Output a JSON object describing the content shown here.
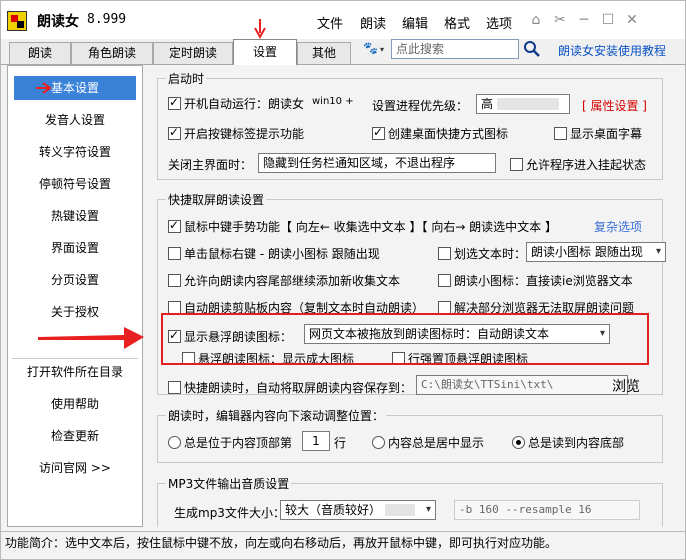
{
  "app": {
    "title": "朗读女",
    "version": "8.999"
  },
  "menu": [
    "文件",
    "朗读",
    "编辑",
    "格式",
    "选项"
  ],
  "tabs": [
    "朗读",
    "角色朗读",
    "定时朗读",
    "设置",
    "其他"
  ],
  "search": {
    "placeholder": "点此搜索"
  },
  "help_link": "朗读女安装使用教程",
  "sidebar": {
    "top": [
      "基本设置",
      "发音人设置",
      "转义字符设置",
      "停顿符号设置",
      "热键设置",
      "界面设置",
      "分页设置",
      "关于授权"
    ],
    "bottom": [
      "打开软件所在目录",
      "使用帮助",
      "检查更新",
      "访问官网 >>"
    ]
  },
  "startup": {
    "title": "启动时",
    "autorun": "开机自动运行：朗读女",
    "os": "win10 +",
    "priority_label": "设置进程优先级：",
    "priority_value": "高",
    "attr_link": "[ 属性设置 ]",
    "shortcut_gesture": "开启按键标签提示功能",
    "desktop_icon": "创建桌面快捷方式图标",
    "desktop_subtitle": "显示桌面字幕",
    "close_label": "关闭主界面时：",
    "close_value": "隐藏到任务栏通知区域，不退出程序",
    "allow_suspend": "允许程序进入挂起状态"
  },
  "capture": {
    "title": "快捷取屏朗读设置",
    "middle_gesture": "鼠标中键手势功能【 向左← 收集选中文本 】【 向右→ 朗读选中文本 】",
    "restore": "复杂选项",
    "right_click": "单击鼠标右键 - 朗读小图标 跟随出现",
    "select_text_label": "划选文本时：",
    "select_text_value": "朗读小图标 跟随出现",
    "allow_append": "允许向朗读内容尾部继续添加新收集文本",
    "mini_icon": "朗读小图标：直接读ie浏览器文本",
    "auto_clip": "自动朗读剪贴板内容（复制文本时自动朗读）",
    "solve_browser": "解决部分浏览器无法取屏朗读问题",
    "float_icon": "显示悬浮朗读图标：",
    "float_value": "网页文本被拖放到朗读图标时：自动朗读文本",
    "float_big": "悬浮朗读图标：显示成大图标",
    "float_top": "行强置顶悬浮朗读图标",
    "save_label": "快捷朗读时，自动将取屏朗读内容保存到：",
    "save_path": "C:\\朗读女\\TTSini\\txt\\",
    "browse": "浏览"
  },
  "scroll": {
    "title": "朗读时，编辑器内容向下滚动调整位置：",
    "opt1_a": "总是位于内容顶部第",
    "opt1_num": "1",
    "opt1_b": "行",
    "opt2": "内容总是居中显示",
    "opt3": "总是读到内容底部"
  },
  "mp3": {
    "title": "MP3文件输出音质设置",
    "label": "生成mp3文件大小：",
    "value": "较大（音质较好）",
    "params": "-b 160 --resample 16"
  },
  "status": "功能简介：选中文本后，按住鼠标中键不放，向左或向右移动后，再放开鼠标中键，即可执行对应功能。"
}
